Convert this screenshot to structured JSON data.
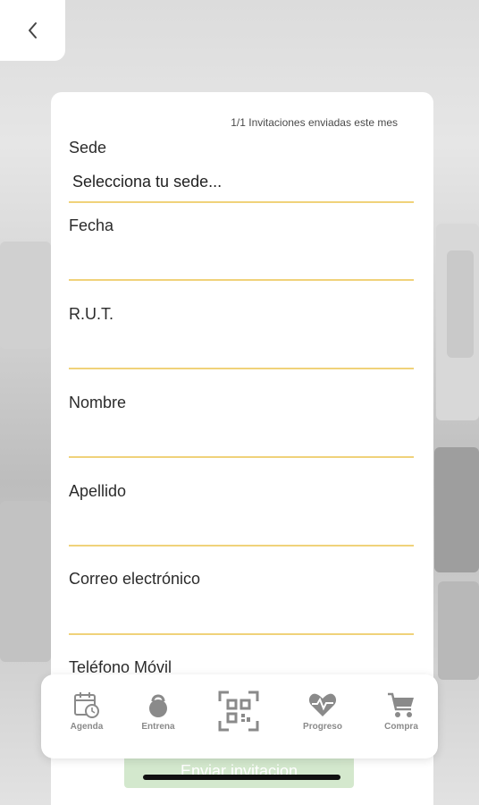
{
  "header": {
    "back_icon": "chevron-left-icon"
  },
  "form": {
    "counter": "1/1 Invitaciones enviadas este mes",
    "fields": {
      "sede": {
        "label": "Sede",
        "value": "Selecciona tu sede..."
      },
      "fecha": {
        "label": "Fecha",
        "value": ""
      },
      "rut": {
        "label": "R.U.T.",
        "value": ""
      },
      "nombre": {
        "label": "Nombre",
        "value": ""
      },
      "apellido": {
        "label": "Apellido",
        "value": ""
      },
      "correo": {
        "label": "Correo electrónico",
        "value": ""
      },
      "telefono": {
        "label": "Teléfono Móvil",
        "value": ""
      }
    },
    "submit_label": "Enviar invitacion"
  },
  "tabbar": {
    "items": [
      {
        "label": "Agenda",
        "icon": "calendar-clock-icon"
      },
      {
        "label": "Entrena",
        "icon": "kettlebell-icon"
      },
      {
        "label": "",
        "icon": "qr-code-icon"
      },
      {
        "label": "Progreso",
        "icon": "heart-pulse-icon"
      },
      {
        "label": "Compra",
        "icon": "cart-icon"
      }
    ]
  },
  "colors": {
    "accent_line": "#f0d27a",
    "tab_icon": "#8a8a8a",
    "submit_bg": "#cfe6c8"
  }
}
